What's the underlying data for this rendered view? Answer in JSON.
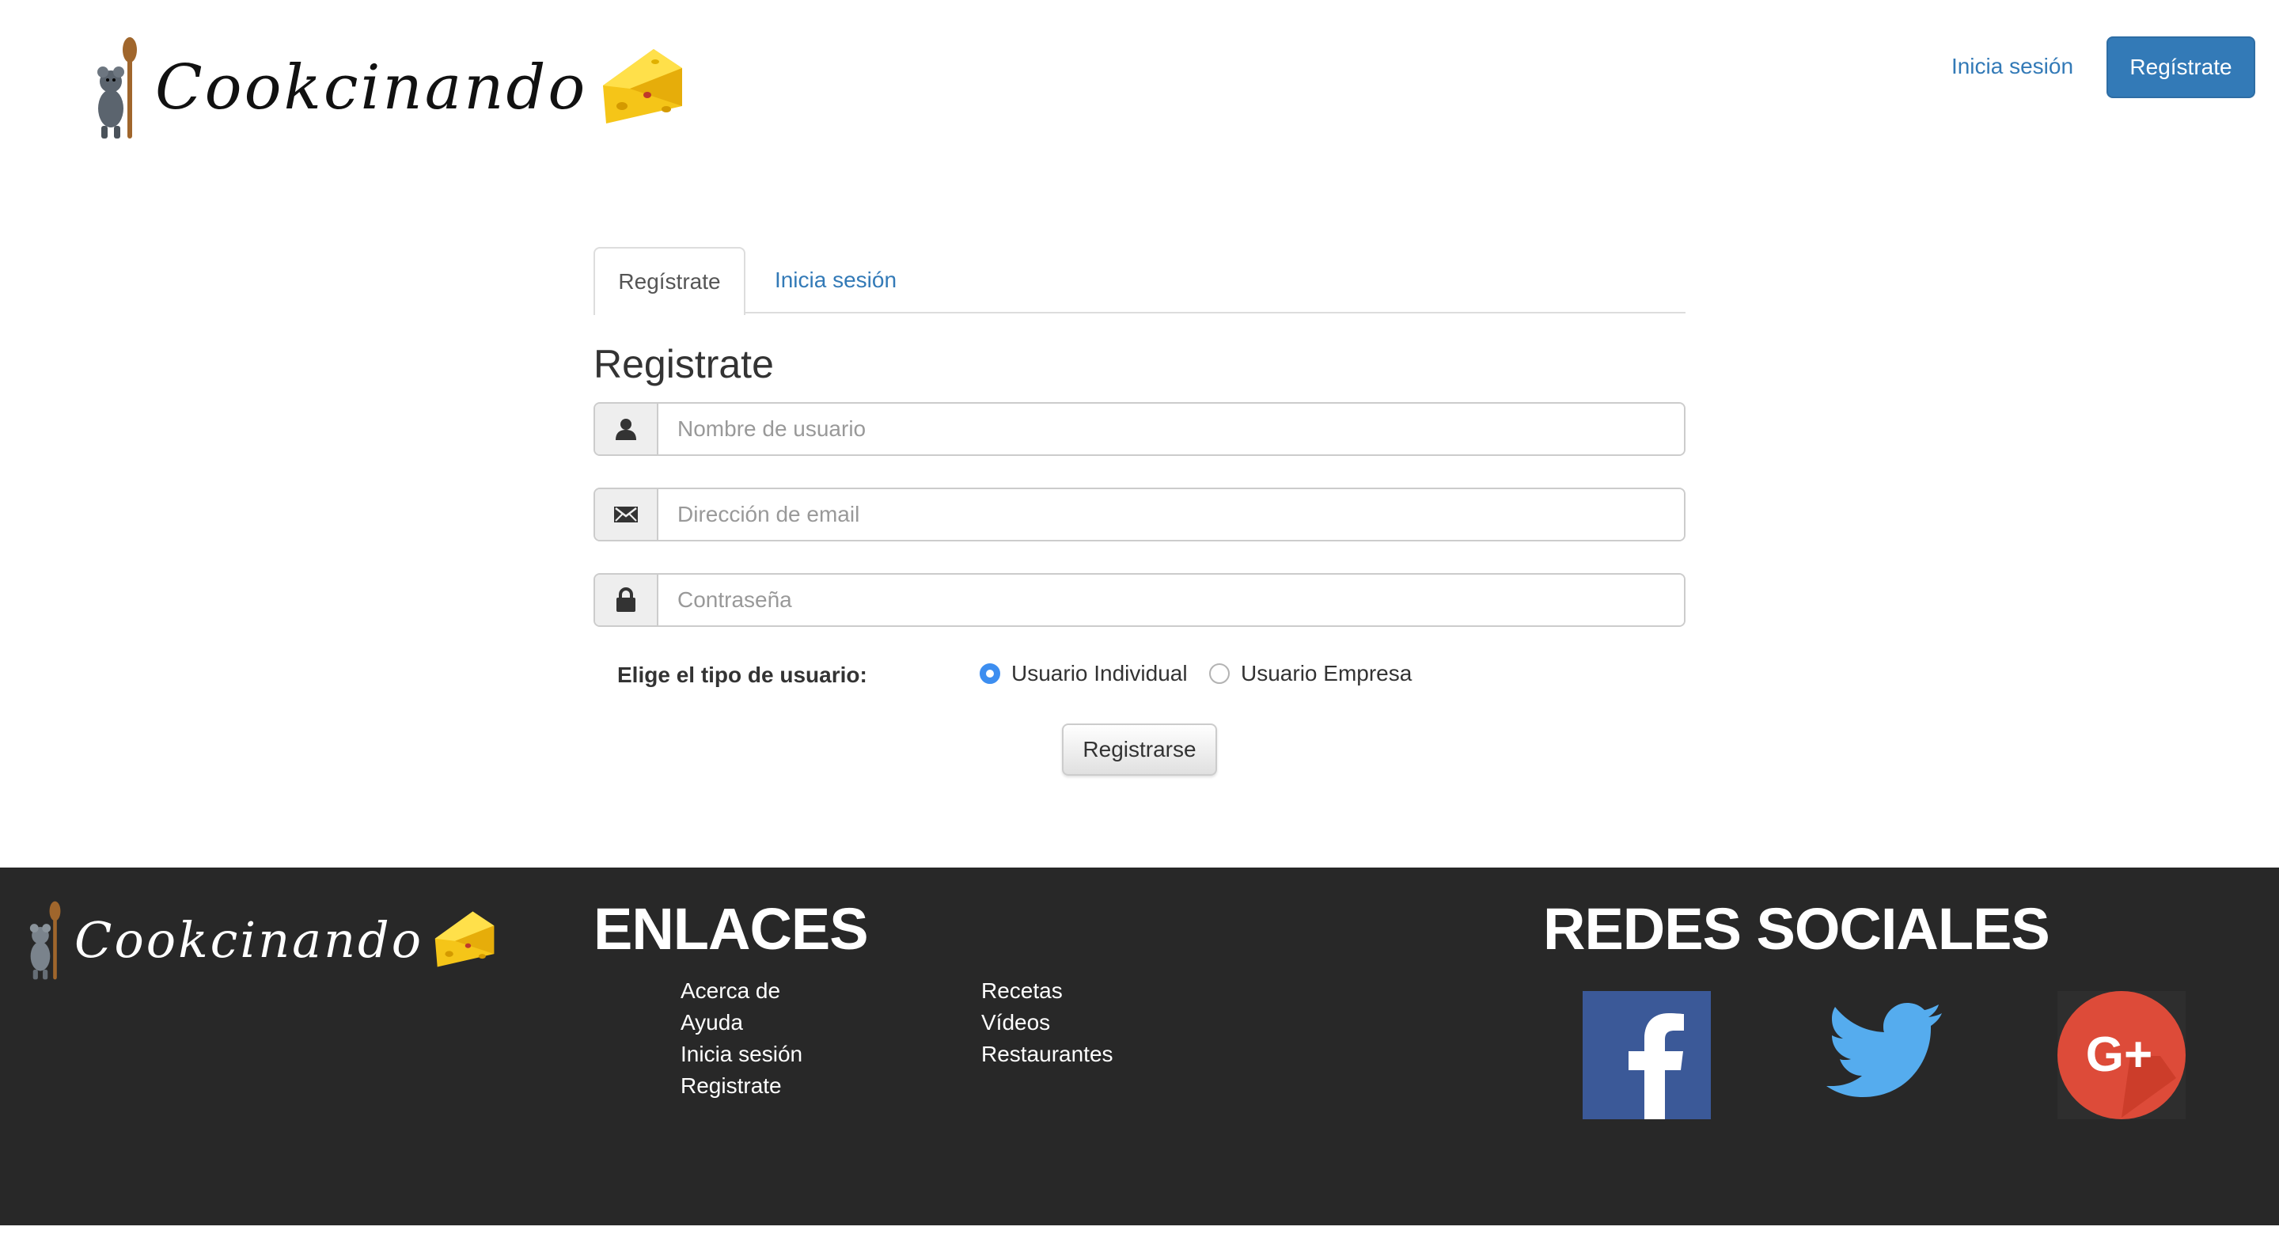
{
  "brand": {
    "name": "Cookcinando"
  },
  "header": {
    "login_link": "Inicia sesión",
    "register_button": "Regístrate"
  },
  "tabs": [
    {
      "label": "Regístrate",
      "active": true
    },
    {
      "label": "Inicia sesión",
      "active": false
    }
  ],
  "form": {
    "title": "Registrate",
    "username": {
      "placeholder": "Nombre de usuario",
      "value": "",
      "icon": "user-icon"
    },
    "email": {
      "placeholder": "Dirección de email",
      "value": "",
      "icon": "envelope-icon"
    },
    "password": {
      "placeholder": "Contraseña",
      "value": "",
      "icon": "lock-icon"
    },
    "user_type_label": "Elige el tipo de usuario:",
    "user_type_options": [
      {
        "label": "Usuario Individual",
        "selected": true
      },
      {
        "label": "Usuario Empresa",
        "selected": false
      }
    ],
    "submit_label": "Registrarse"
  },
  "footer": {
    "links_heading": "ENLACES",
    "links_col1": [
      "Acerca de",
      "Ayuda",
      "Inicia sesión",
      "Registrate"
    ],
    "links_col2": [
      "Recetas",
      "Vídeos",
      "Restaurantes"
    ],
    "social_heading": "REDES SOCIALES",
    "social": [
      {
        "name": "facebook-icon",
        "color": "#3b5998"
      },
      {
        "name": "twitter-icon",
        "color": "#55acee"
      },
      {
        "name": "google-plus-icon",
        "color": "#dd4b39"
      }
    ]
  },
  "colors": {
    "primary": "#337ab7",
    "footer_bg": "#282828",
    "radio_checked": "#3d8ef0"
  }
}
